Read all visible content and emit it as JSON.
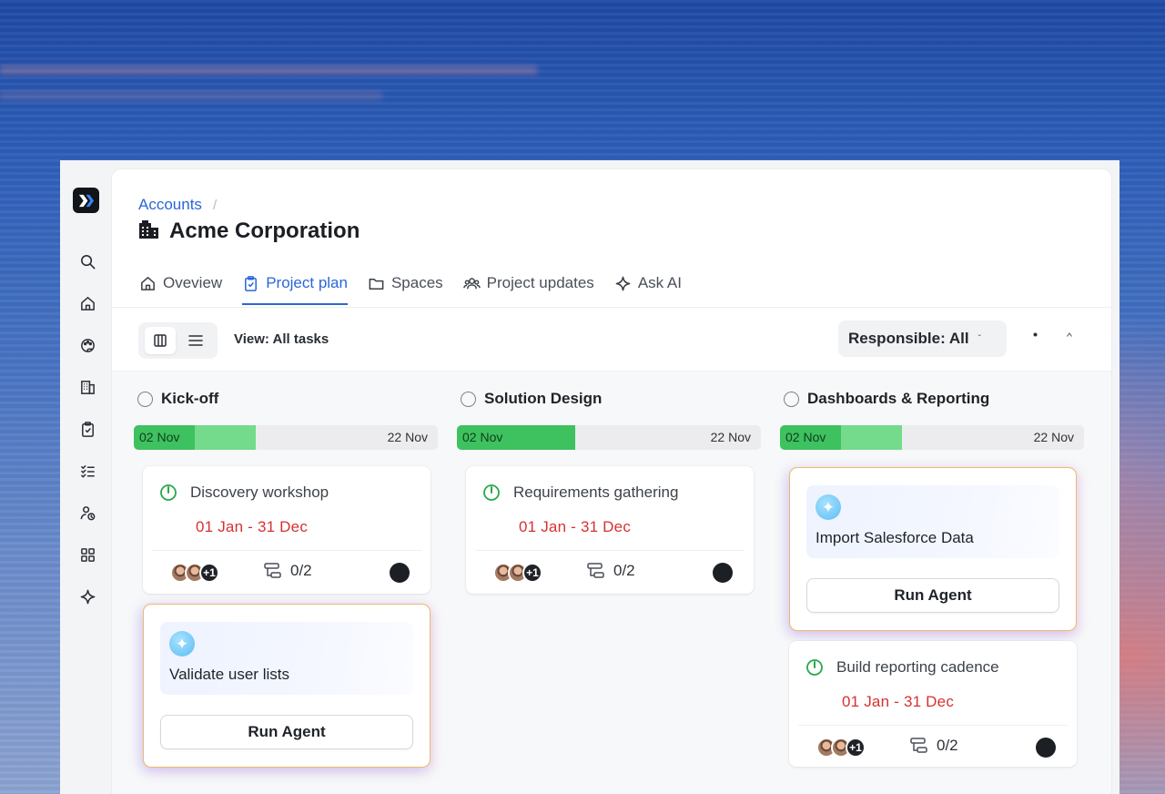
{
  "breadcrumb": {
    "parent": "Accounts",
    "separator": "/"
  },
  "page_title": "Acme Corporation",
  "tabs": [
    {
      "label": "Oveview",
      "icon": "home-icon",
      "active": false
    },
    {
      "label": "Project plan",
      "icon": "clipboard-check-icon",
      "active": true
    },
    {
      "label": "Spaces",
      "icon": "folder-icon",
      "active": false
    },
    {
      "label": "Project updates",
      "icon": "users-icon",
      "active": false
    },
    {
      "label": "Ask AI",
      "icon": "sparkle-icon",
      "active": false
    }
  ],
  "toolbar": {
    "view_label": "View: All tasks",
    "responsible_filter": "Responsible: All",
    "responsible_chevron": "ˇ"
  },
  "sidebar": {
    "items": [
      "search-icon",
      "home-icon",
      "palette-icon",
      "building-icon",
      "clipboard-check-icon",
      "checklist-icon",
      "user-clock-icon",
      "grid-icon",
      "sparkle-icon"
    ]
  },
  "columns": [
    {
      "name": "Kick-off",
      "start_date": "02 Nov",
      "end_date": "22 Nov",
      "progress_done": 0.2,
      "progress_in_progress": 0.2,
      "task": {
        "title": "Discovery workshop",
        "dates": "01 Jan - 31 Dec",
        "extra_assignees": "+1",
        "subtasks": "0/2"
      },
      "agent": {
        "title": "Validate user lists",
        "button": "Run Agent"
      }
    },
    {
      "name": "Solution Design",
      "start_date": "02 Nov",
      "end_date": "22 Nov",
      "progress_done": 0.39,
      "progress_in_progress": 0,
      "task": {
        "title": "Requirements gathering",
        "dates": "01 Jan - 31 Dec",
        "extra_assignees": "+1",
        "subtasks": "0/2"
      }
    },
    {
      "name": "Dashboards & Reporting",
      "start_date": "02 Nov",
      "end_date": "22 Nov",
      "progress_done": 0.2,
      "progress_in_progress": 0.2,
      "agent": {
        "title": "Import Salesforce Data",
        "button": "Run Agent"
      },
      "task": {
        "title": "Build reporting cadence",
        "dates": "01 Jan - 31 Dec",
        "extra_assignees": "+1",
        "subtasks": "0/2"
      }
    }
  ],
  "colors": {
    "accent": "#2b66d6",
    "date_red": "#d63131",
    "progress_done": "#3ec15f",
    "progress_active": "#74da8c",
    "agent_border": "#f0b76a"
  }
}
